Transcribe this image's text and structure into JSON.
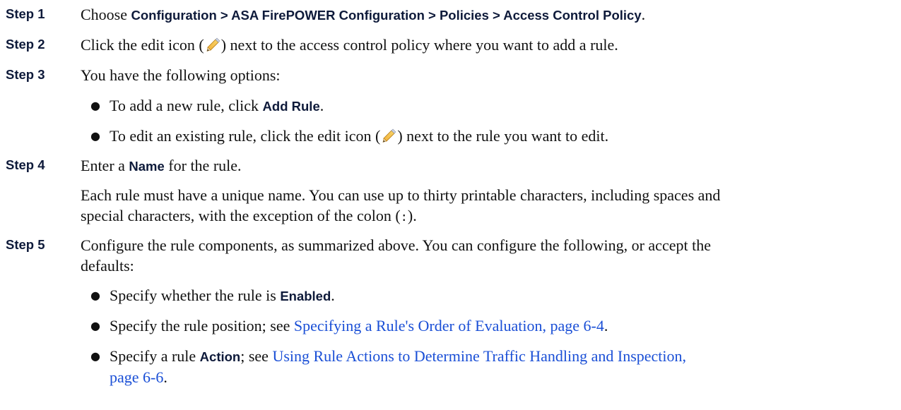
{
  "steps": [
    {
      "label": "Step 1",
      "text_1": "Choose ",
      "bold_1": "Configuration > ASA FirePOWER Configuration > Policies > Access Control Policy",
      "text_2": "."
    },
    {
      "label": "Step 2",
      "text_1": "Click the edit icon (",
      "icon": "pencil-edit-icon",
      "text_2": ") next to the access control policy where you want to add a rule."
    },
    {
      "label": "Step 3",
      "text": "You have the following options:",
      "bullets": [
        {
          "text_1": "To add a new rule, click ",
          "bold": "Add Rule",
          "text_2": "."
        },
        {
          "text_1": "To edit an existing rule, click the edit icon (",
          "icon": "pencil-edit-icon",
          "text_2": ") next to the rule you want to edit."
        }
      ]
    },
    {
      "label": "Step 4",
      "text_1": "Enter a ",
      "bold": "Name",
      "text_2": " for the rule.",
      "para_1": "Each rule must have a unique name. You can use up to thirty printable characters, including spaces and",
      "para_2a": "special characters, with the exception of the colon (",
      "para_colon": ":",
      "para_2b": ")."
    },
    {
      "label": "Step 5",
      "line_1": "Configure the rule components, as summarized above. You can configure the following, or accept the",
      "line_2": "defaults:",
      "bullets": [
        {
          "text_1": "Specify whether the rule is ",
          "bold": "Enabled",
          "text_2": "."
        },
        {
          "text_1": "Specify the rule position; see ",
          "link": "Specifying a Rule's Order of Evaluation, page 6-4",
          "text_2": "."
        },
        {
          "text_1": "Specify a rule ",
          "bold": "Action",
          "text_2": "; see ",
          "link_1": "Using Rule Actions to Determine Traffic Handling and Inspection,",
          "link_2": "page 6-6",
          "text_3": "."
        }
      ]
    }
  ],
  "colors": {
    "text": "#111111",
    "label": "#0e1a3a",
    "link": "#1a4fd6"
  }
}
